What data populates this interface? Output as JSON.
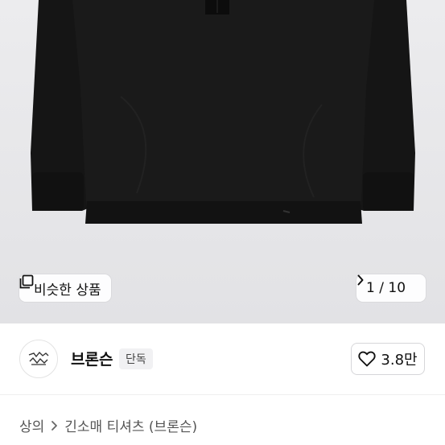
{
  "gallery": {
    "similar_label": "비슷한 상품",
    "current": "1",
    "total": "10",
    "counter_sep": " / "
  },
  "seller": {
    "name": "브론슨",
    "badge": "단독",
    "likes": "3.8만"
  },
  "breadcrumb": {
    "category": "상의",
    "subcategory": "긴소매 티셔츠 (브론슨)"
  },
  "icons": {
    "similar": "similar-items-icon",
    "next": "chevron-right-icon",
    "like": "heart-icon",
    "crumb": "chevron-right-icon"
  }
}
